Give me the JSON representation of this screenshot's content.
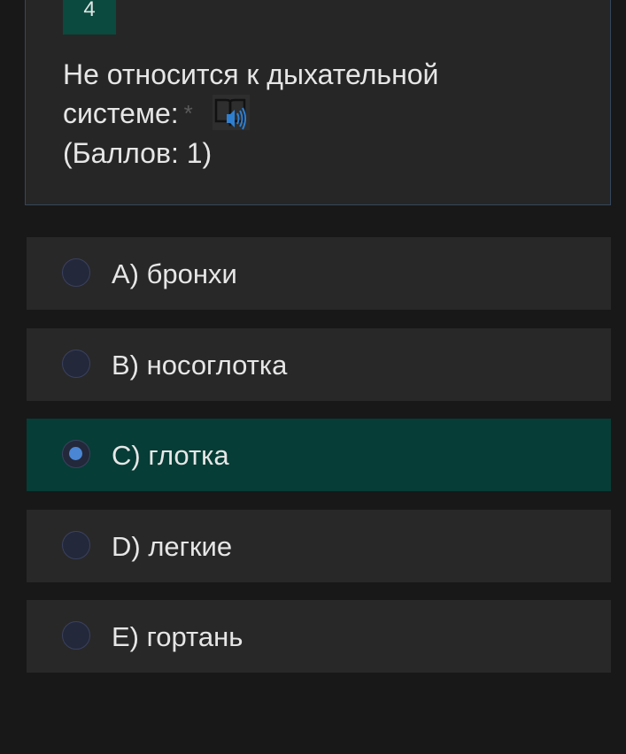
{
  "question": {
    "number": "4",
    "text_line1": "Не относится к дыхательной",
    "text_line2": "системе:",
    "required_marker": "*",
    "points": "(Баллов: 1)",
    "audio_icon": "speaker-book-icon"
  },
  "options": [
    {
      "label": "A) бронхи",
      "selected": false
    },
    {
      "label": "B) носоглотка",
      "selected": false
    },
    {
      "label": "C) глотка",
      "selected": true
    },
    {
      "label": "D) легкие",
      "selected": false
    },
    {
      "label": "E) гортань",
      "selected": false
    }
  ],
  "colors": {
    "background": "#181818",
    "card": "#262626",
    "number_badge": "#0b4a3e",
    "selected_option": "#063d36",
    "radio_dot": "#4a86d4"
  }
}
